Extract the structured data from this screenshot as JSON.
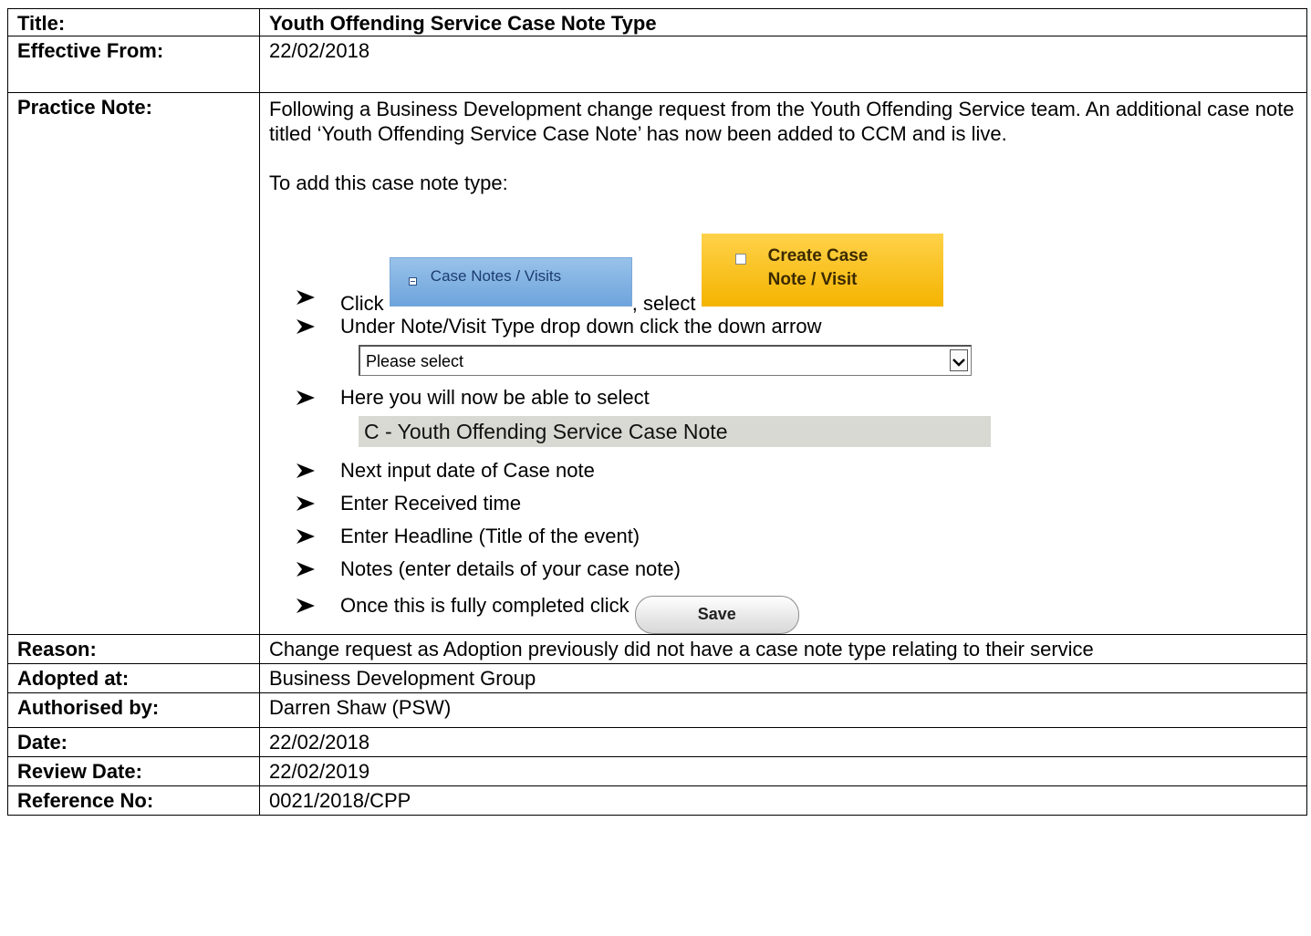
{
  "rows": {
    "title": {
      "label": "Title:",
      "value": "Youth Offending Service Case Note Type"
    },
    "effective_from": {
      "label": "Effective From:",
      "value": "22/02/2018"
    },
    "practice_note": {
      "label": "Practice Note:",
      "intro": "Following a Business Development change request from the Youth Offending Service team. An additional case note titled ‘Youth Offending Service Case Note’ has now been added to CCM and is live.",
      "how_to": "To add this case note type:",
      "steps": {
        "click_text": "Click",
        "case_notes_button": "Case Notes / Visits",
        "select_text": ", select",
        "create_button_line1": "Create Case",
        "create_button_line2": "Note / Visit",
        "step2": "Under Note/Visit Type drop down click the down arrow",
        "dropdown_value": "Please select",
        "step3": "Here you will now be able to select",
        "option_text": "C - Youth Offending Service Case Note",
        "step4": "Next input date of Case note",
        "step5": "Enter Received time",
        "step6": "Enter Headline (Title of the event)",
        "step7": "Notes (enter details of your case note)",
        "step8": "Once this is fully completed click",
        "save_button": "Save"
      }
    },
    "reason": {
      "label": "Reason:",
      "value": "Change request as Adoption previously did not have a case note type relating to their service"
    },
    "adopted_at": {
      "label": "Adopted at:",
      "value": "Business Development Group"
    },
    "authorised_by": {
      "label": "Authorised by:",
      "value": "Darren Shaw (PSW)"
    },
    "date": {
      "label": "Date:",
      "value": "22/02/2018"
    },
    "review_date": {
      "label": "Review Date:",
      "value": "22/02/2019"
    },
    "reference_no": {
      "label": "Reference No:",
      "value": "0021/2018/CPP"
    }
  }
}
